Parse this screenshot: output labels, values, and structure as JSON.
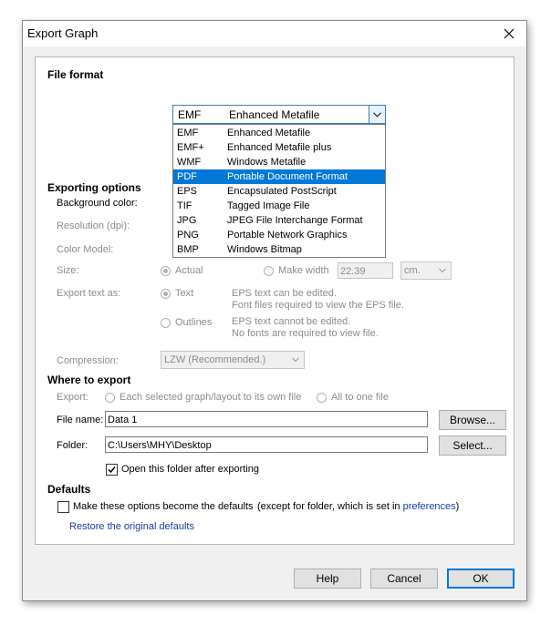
{
  "window": {
    "title": "Export Graph",
    "close_label": "close"
  },
  "file_format": {
    "heading": "File format",
    "selected_code": "EMF",
    "selected_desc": "Enhanced Metafile",
    "highlighted_index": 3,
    "options": [
      {
        "code": "EMF",
        "desc": "Enhanced Metafile"
      },
      {
        "code": "EMF+",
        "desc": "Enhanced Metafile plus"
      },
      {
        "code": "WMF",
        "desc": "Windows Metafile"
      },
      {
        "code": "PDF",
        "desc": "Portable Document Format"
      },
      {
        "code": "EPS",
        "desc": "Encapsulated PostScript"
      },
      {
        "code": "TIF",
        "desc": "Tagged Image File"
      },
      {
        "code": "JPG",
        "desc": "JPEG File Interchange Format"
      },
      {
        "code": "PNG",
        "desc": "Portable Network Graphics"
      },
      {
        "code": "BMP",
        "desc": "Windows Bitmap"
      }
    ]
  },
  "exporting_options": {
    "heading": "Exporting options",
    "background_color_label": "Background color:",
    "resolution_label": "Resolution (dpi):",
    "color_model_label": "Color Model:",
    "size_label": "Size:",
    "size_actual": "Actual",
    "size_make_width": "Make width",
    "width_value": "22.39",
    "width_unit": "cm.",
    "export_text_label": "Export text as:",
    "text_option": "Text",
    "text_note_1": "EPS text can be edited.",
    "text_note_2": "Font files required to view the EPS file.",
    "outlines_option": "Outlines",
    "outlines_note_1": "EPS text cannot be edited.",
    "outlines_note_2": "No fonts are required to view file.",
    "compression_label": "Compression:",
    "compression_value": "LZW (Recommended.)"
  },
  "where_to_export": {
    "heading": "Where to export",
    "export_label": "Export:",
    "each_option": "Each selected graph/layout to its own file",
    "all_option": "All to one file",
    "file_name_label": "File name:",
    "file_name_value": "Data 1",
    "browse_label": "Browse...",
    "folder_label": "Folder:",
    "folder_value": "C:\\Users\\MHY\\Desktop",
    "select_label": "Select...",
    "open_folder_label": "Open this folder after exporting",
    "open_folder_checked": true
  },
  "defaults": {
    "heading": "Defaults",
    "make_default_label": "Make these options become the defaults",
    "except_text": "(except for folder, which is set in",
    "preferences_link": "preferences",
    "close_paren": ")",
    "restore_link": "Restore the original defaults"
  },
  "buttons": {
    "help": "Help",
    "cancel": "Cancel",
    "ok": "OK"
  },
  "colors": {
    "accent": "#0078d7",
    "link": "#1a3aa8",
    "disabled_text": "#8c8c8c"
  }
}
